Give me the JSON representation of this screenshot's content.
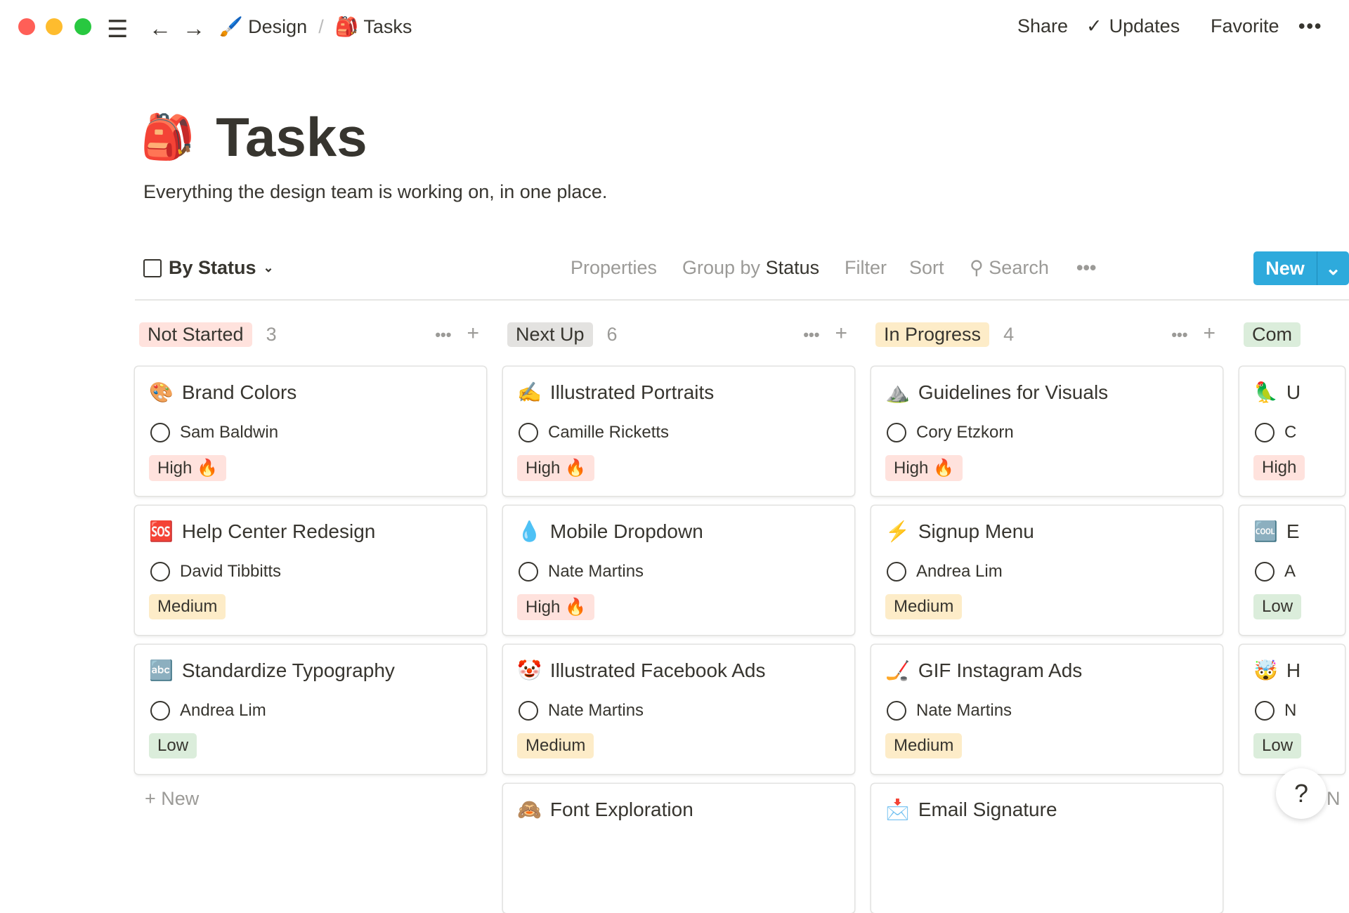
{
  "window": {
    "traffic_lights": [
      "#ff5f57",
      "#febc2e",
      "#28c840"
    ]
  },
  "breadcrumb": [
    {
      "icon": "🖌️",
      "label": "Design"
    },
    {
      "icon": "🎒",
      "label": "Tasks"
    }
  ],
  "breadcrumb_sep": "/",
  "topbar": {
    "share": "Share",
    "updates": "Updates",
    "favorite": "Favorite",
    "more": "•••"
  },
  "page": {
    "icon": "🎒",
    "title": "Tasks",
    "description": "Everything the design team is working on, in one place."
  },
  "toolbar": {
    "view": "By Status",
    "properties": "Properties",
    "group_by": "Group by",
    "group_value": "Status",
    "filter": "Filter",
    "sort": "Sort",
    "search": "Search",
    "more": "•••",
    "new": "New"
  },
  "colors": {
    "accent": "#2eaadc",
    "high": "#ffe2dd",
    "medium": "#fdecc8",
    "low": "#dbeddb",
    "next": "#e3e2e0"
  },
  "columns": [
    {
      "label": "Not Started",
      "count": "3",
      "color": "#ffe2dd",
      "cards": [
        {
          "icon": "🎨",
          "title": "Brand Colors",
          "person": "Sam Baldwin",
          "priority": "High 🔥",
          "pcolor": "#ffe2dd"
        },
        {
          "icon": "🆘",
          "title": "Help Center Redesign",
          "person": "David Tibbitts",
          "priority": "Medium",
          "pcolor": "#fdecc8"
        },
        {
          "icon": "🔤",
          "title": "Standardize Typography",
          "person": "Andrea Lim",
          "priority": "Low",
          "pcolor": "#dbeddb"
        }
      ],
      "add": "New"
    },
    {
      "label": "Next Up",
      "count": "6",
      "color": "#e3e2e0",
      "cards": [
        {
          "icon": "✍️",
          "title": "Illustrated Portraits",
          "person": "Camille Ricketts",
          "priority": "High 🔥",
          "pcolor": "#ffe2dd"
        },
        {
          "icon": "💧",
          "title": "Mobile Dropdown",
          "person": "Nate Martins",
          "priority": "High 🔥",
          "pcolor": "#ffe2dd"
        },
        {
          "icon": "🤡",
          "title": "Illustrated Facebook Ads",
          "person": "Nate Martins",
          "priority": "Medium",
          "pcolor": "#fdecc8"
        },
        {
          "icon": "🙈",
          "title": "Font Exploration",
          "person": "",
          "priority": "",
          "pcolor": ""
        }
      ]
    },
    {
      "label": "In Progress",
      "count": "4",
      "color": "#fdecc8",
      "cards": [
        {
          "icon": "⛰️",
          "title": "Guidelines for Visuals",
          "person": "Cory Etzkorn",
          "priority": "High 🔥",
          "pcolor": "#ffe2dd"
        },
        {
          "icon": "⚡",
          "title": "Signup Menu",
          "person": "Andrea Lim",
          "priority": "Medium",
          "pcolor": "#fdecc8"
        },
        {
          "icon": "🏒",
          "title": "GIF Instagram Ads",
          "person": "Nate Martins",
          "priority": "Medium",
          "pcolor": "#fdecc8"
        },
        {
          "icon": "📩",
          "title": "Email Signature",
          "person": "",
          "priority": "",
          "pcolor": ""
        }
      ]
    },
    {
      "label": "Com",
      "count": "",
      "color": "#dbeddb",
      "cards": [
        {
          "icon": "🦜",
          "title": "U",
          "person": "C",
          "priority": "High",
          "pcolor": "#ffe2dd"
        },
        {
          "icon": "🆒",
          "title": "E",
          "person": "A",
          "priority": "Low",
          "pcolor": "#dbeddb"
        },
        {
          "icon": "🤯",
          "title": "H",
          "person": "N",
          "priority": "Low",
          "pcolor": "#dbeddb"
        }
      ],
      "add": "N"
    }
  ],
  "help": "?"
}
